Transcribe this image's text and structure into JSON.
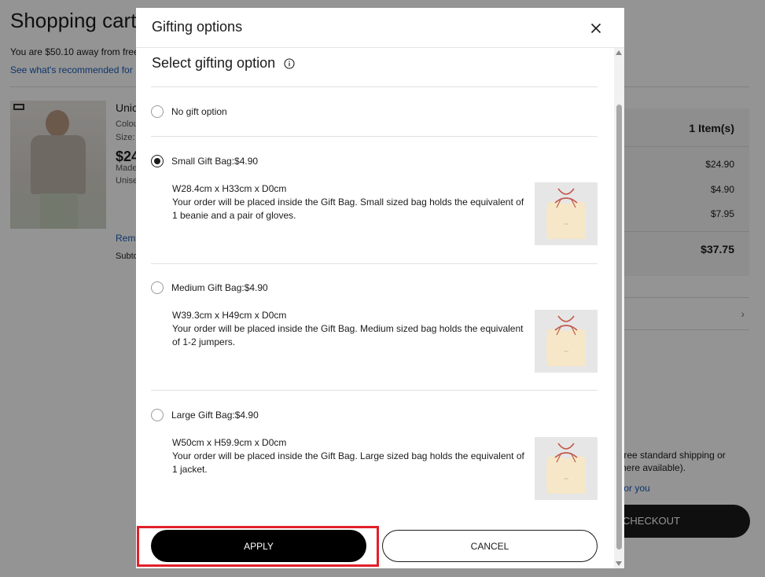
{
  "background": {
    "page_title": "Shopping cart",
    "away_text": "You are $50.10 away from free",
    "recommend_link": "See what's recommended for",
    "product": {
      "name": "Unic",
      "colour_label": "Colou",
      "size_label": "Size:",
      "price": "$24",
      "made_label": "Made",
      "unisex_label": "Unise",
      "remove_link": "Rem",
      "subtotal_label": "Subto"
    },
    "summary": {
      "items": "1 Item(s)",
      "line1": "$24.90",
      "line2": "$4.90",
      "line3": "$7.95",
      "total": "$37.75"
    },
    "shipping_text_1": "free standard shipping or",
    "shipping_text_2": "here available).",
    "for_you_link": "for you",
    "checkout_label": "CHECKOUT"
  },
  "modal": {
    "title": "Gifting options",
    "section_title": "Select gifting option",
    "options": [
      {
        "label": "No gift option",
        "selected": false
      },
      {
        "label": "Small Gift Bag:$4.90",
        "selected": true,
        "dimensions": "W28.4cm x H33cm x D0cm",
        "description": "Your order will be placed inside the Gift Bag. Small sized bag holds the equivalent of 1 beanie and a pair of gloves."
      },
      {
        "label": "Medium Gift Bag:$4.90",
        "selected": false,
        "dimensions": "W39.3cm x H49cm x D0cm",
        "description": "Your order will be placed inside the Gift Bag. Medium sized bag holds the equivalent of 1-2 jumpers."
      },
      {
        "label": "Large Gift Bag:$4.90",
        "selected": false,
        "dimensions": "W50cm x H59.9cm x D0cm",
        "description": "Your order will be placed inside the Gift Bag. Large sized bag holds the equivalent of 1 jacket."
      }
    ],
    "apply_label": "APPLY",
    "cancel_label": "CANCEL"
  },
  "icons": {
    "close": "close-icon",
    "info": "info-icon",
    "gift_bag": "gift-bag-image"
  },
  "colors": {
    "highlight": "#e0202a",
    "primary_button": "#000000",
    "link": "#1a5bb8"
  }
}
